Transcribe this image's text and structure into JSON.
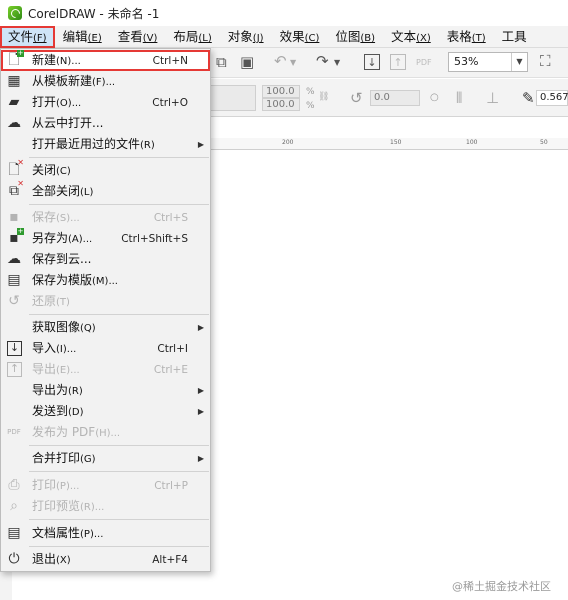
{
  "window": {
    "title": "CorelDRAW - 未命名 -1"
  },
  "menubar": [
    {
      "label": "文件",
      "accel": "(F)",
      "active": true
    },
    {
      "label": "编辑",
      "accel": "(E)"
    },
    {
      "label": "查看",
      "accel": "(V)"
    },
    {
      "label": "布局",
      "accel": "(L)"
    },
    {
      "label": "对象",
      "accel": "(J)"
    },
    {
      "label": "效果",
      "accel": "(C)"
    },
    {
      "label": "位图",
      "accel": "(B)"
    },
    {
      "label": "文本",
      "accel": "(X)"
    },
    {
      "label": "表格",
      "accel": "(T)"
    },
    {
      "label": "工具",
      "accel": ""
    }
  ],
  "toolbar": {
    "zoom": "53%",
    "width_pct": "100.0",
    "height_pct": "100.0",
    "rotation": "0.0",
    "outline": "0.567",
    "pct_sign": "%"
  },
  "ruler": {
    "ticks": [
      "200",
      "150",
      "100",
      "50"
    ]
  },
  "file_menu": {
    "items": [
      {
        "label": "新建",
        "accel": "(N)...",
        "shortcut": "Ctrl+N",
        "icon": "new-document-icon",
        "highlighted": true
      },
      {
        "label": "从模板新建",
        "accel": "(F)...",
        "shortcut": "",
        "icon": "new-from-template-icon"
      },
      {
        "label": "打开",
        "accel": "(O)...",
        "shortcut": "Ctrl+O",
        "icon": "open-folder-icon"
      },
      {
        "label": "从云中打开...",
        "accel": "",
        "shortcut": "",
        "icon": "cloud-open-icon"
      },
      {
        "label": "打开最近用过的文件",
        "accel": "(R)",
        "shortcut": "",
        "submenu": true
      },
      {
        "label": "关闭",
        "accel": "(C)",
        "shortcut": "",
        "icon": "close-document-icon"
      },
      {
        "label": "全部关闭",
        "accel": "(L)",
        "shortcut": "",
        "icon": "close-all-icon"
      },
      {
        "label": "保存",
        "accel": "(S)...",
        "shortcut": "Ctrl+S",
        "icon": "save-icon",
        "disabled": true
      },
      {
        "label": "另存为",
        "accel": "(A)...",
        "shortcut": "Ctrl+Shift+S",
        "icon": "save-as-icon"
      },
      {
        "label": "保存到云...",
        "accel": "",
        "shortcut": "",
        "icon": "cloud-save-icon"
      },
      {
        "label": "保存为模版",
        "accel": "(M)...",
        "shortcut": "",
        "icon": "save-template-icon"
      },
      {
        "label": "还原",
        "accel": "(T)",
        "shortcut": "",
        "icon": "revert-icon",
        "disabled": true
      },
      {
        "label": "获取图像",
        "accel": "(Q)",
        "shortcut": "",
        "submenu": true
      },
      {
        "label": "导入",
        "accel": "(I)...",
        "shortcut": "Ctrl+I",
        "icon": "import-icon"
      },
      {
        "label": "导出",
        "accel": "(E)...",
        "shortcut": "Ctrl+E",
        "icon": "export-icon",
        "disabled": true
      },
      {
        "label": "导出为",
        "accel": "(R)",
        "shortcut": "",
        "submenu": true
      },
      {
        "label": "发送到",
        "accel": "(D)",
        "shortcut": "",
        "submenu": true
      },
      {
        "label": "发布为 PDF",
        "accel": "(H)...",
        "shortcut": "",
        "icon": "pdf-icon",
        "disabled": true
      },
      {
        "label": "合并打印",
        "accel": "(G)",
        "shortcut": "",
        "submenu": true
      },
      {
        "label": "打印",
        "accel": "(P)...",
        "shortcut": "Ctrl+P",
        "icon": "print-icon",
        "disabled": true
      },
      {
        "label": "打印预览",
        "accel": "(R)...",
        "shortcut": "",
        "icon": "print-preview-icon",
        "disabled": true
      },
      {
        "label": "文档属性",
        "accel": "(P)...",
        "shortcut": "",
        "icon": "document-properties-icon"
      },
      {
        "label": "退出",
        "accel": "(X)",
        "shortcut": "Alt+F4",
        "icon": "power-icon"
      }
    ]
  },
  "watermark": "@稀土掘金技术社区",
  "colors": {
    "highlight_outline": "#e53935",
    "menu_bg": "#f2f2f2",
    "disabled_text": "#b3b3b3"
  }
}
